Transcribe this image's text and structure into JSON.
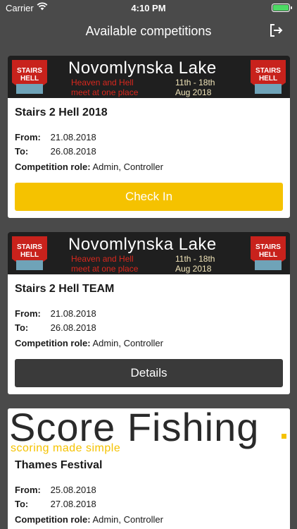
{
  "status_bar": {
    "carrier": "Carrier",
    "time": "4:10 PM"
  },
  "nav": {
    "title": "Available competitions",
    "logout_icon": "logout-icon"
  },
  "colors": {
    "background": "#4a4a4a",
    "accent": "#f5c200",
    "dark_button": "#3a3a3a",
    "battery": "#4cd964"
  },
  "labels": {
    "from": "From:",
    "to": "To:",
    "role": "Competition role:"
  },
  "banners": {
    "s2h": {
      "lake": "Novomlynska Lake",
      "tagline_1": "Heaven and Hell",
      "tagline_2": "meet at one place",
      "date_1": "11th - 18th",
      "date_2": "Aug 2018",
      "logo_text_1": "STAIRS",
      "logo_text_2": "HELL"
    },
    "score_fishing": {
      "title": "Score Fishing",
      "tagline": "scoring made simple"
    }
  },
  "competitions": [
    {
      "name": "Stairs 2 Hell 2018",
      "from": "21.08.2018",
      "to": "26.08.2018",
      "role": "Admin, Controller",
      "button": "Check In"
    },
    {
      "name": "Stairs 2 Hell TEAM",
      "from": "21.08.2018",
      "to": "26.08.2018",
      "role": "Admin, Controller",
      "button": "Details"
    },
    {
      "name": "Thames Festival",
      "from": "25.08.2018",
      "to": "27.08.2018",
      "role": "Admin, Controller"
    }
  ]
}
